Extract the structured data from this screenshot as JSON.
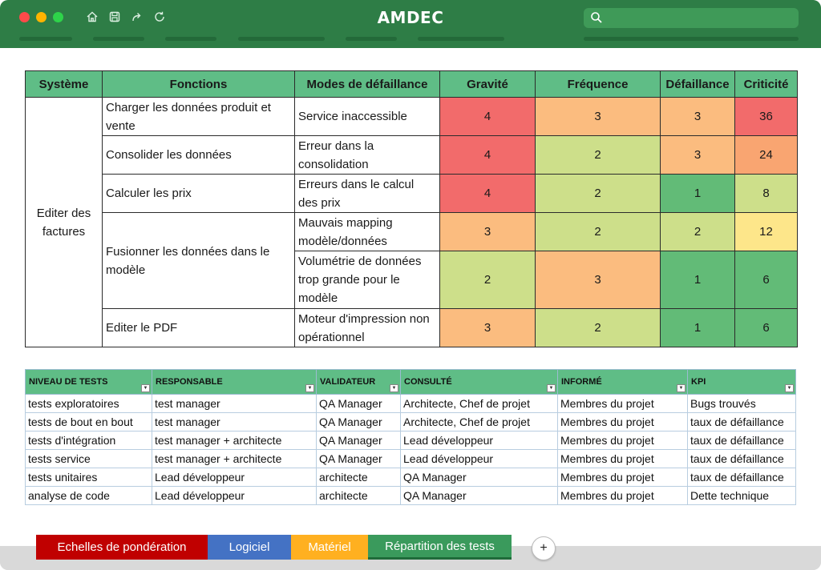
{
  "app": {
    "title": "AMDEC",
    "search_placeholder": ""
  },
  "colors": {
    "titlebar": "#2e7d46",
    "header": "#5fbd86",
    "red": "#f26b6b",
    "orange": "#fbbc7f",
    "lightgreen": "#cddf8a",
    "green": "#62bb77",
    "yellow": "#fde68a",
    "orangered": "#f9a571"
  },
  "amdec": {
    "headers": [
      "Système",
      "Fonctions",
      "Modes de défaillance",
      "Gravité",
      "Fréquence",
      "Défaillance",
      "Criticité"
    ],
    "system": "Editer des factures",
    "functions": [
      "Charger les données produit et vente",
      "Consolider les données",
      "Calculer les prix",
      "Fusionner les données dans le modèle",
      "Editer le PDF"
    ],
    "modes": [
      "Service inaccessible",
      "Erreur dans la consolidation",
      "Erreurs dans le calcul des prix",
      "Mauvais mapping modèle/données",
      "Volumétrie de données trop grande pour le modèle",
      "Moteur d'impression non opérationnel"
    ],
    "gravite": [
      "4",
      "4",
      "4",
      "3",
      "2",
      "3"
    ],
    "frequence": [
      "3",
      "2",
      "2",
      "2",
      "3",
      "2"
    ],
    "defaillance": [
      "3",
      "3",
      "1",
      "2",
      "1",
      "1"
    ],
    "criticite": [
      "36",
      "24",
      "8",
      "12",
      "6",
      "6"
    ]
  },
  "raci": {
    "headers": [
      "NIVEAU DE TESTS",
      "RESPONSABLE",
      "VALIDATEUR",
      "CONSULTÉ",
      "INFORMÉ",
      "KPI"
    ],
    "rows": [
      [
        "tests exploratoires",
        "test manager",
        "QA Manager",
        "Architecte, Chef de projet",
        "Membres du projet",
        "Bugs trouvés"
      ],
      [
        "tests de bout en bout",
        "test manager",
        "QA Manager",
        "Architecte, Chef de projet",
        "Membres du projet",
        "taux de défaillance"
      ],
      [
        "tests d'intégration",
        "test manager + architecte",
        "QA Manager",
        "Lead développeur",
        "Membres du projet",
        "taux de défaillance"
      ],
      [
        "tests service",
        "test manager + architecte",
        "QA Manager",
        "Lead développeur",
        "Membres du projet",
        "taux de défaillance"
      ],
      [
        "tests unitaires",
        "Lead développeur",
        "architecte",
        "QA Manager",
        "Membres du projet",
        "taux de défaillance"
      ],
      [
        "analyse de code",
        "Lead développeur",
        "architecte",
        "QA Manager",
        "Membres du projet",
        "Dette technique"
      ]
    ]
  },
  "tabs": [
    {
      "label": "Echelles de pondération",
      "color": "#c00000"
    },
    {
      "label": "Logiciel",
      "color": "#4472c4"
    },
    {
      "label": "Matériel",
      "color": "#ffb020"
    },
    {
      "label": "Répartition des tests",
      "color": "#3a9a5c"
    }
  ],
  "add_tab_label": "+",
  "icons": [
    "home-icon",
    "save-icon",
    "share-icon",
    "refresh-icon",
    "search-icon"
  ]
}
